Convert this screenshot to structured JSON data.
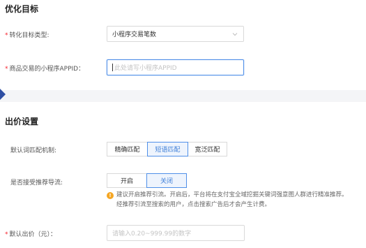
{
  "optimization": {
    "title": "优化目标",
    "conversion_type_label": "转化目标类型:",
    "conversion_type_value": "小程序交易笔数",
    "appid_label": "商品交易的小程序APPID：",
    "appid_placeholder": "此处请写小程序APPID"
  },
  "bidding": {
    "title": "出价设置",
    "keyword_match_label": "默认词匹配机制:",
    "match_options": [
      "精确匹配",
      "短语匹配",
      "宽泛匹配"
    ],
    "match_selected": "短语匹配",
    "recommend_label": "是否接受推荐导流:",
    "recommend_options": [
      "开启",
      "关闭"
    ],
    "recommend_selected": "关闭",
    "hint_line1": "建议开启推荐引流。开启后，平台将在支付宝全域挖掘关键词强意图人群进行精准推荐。",
    "hint_line2": "经推荐引流至搜索的用户，点击搜索广告后才会产生计费。",
    "default_bid_label": "默认出价（元）：",
    "default_bid_placeholder": "请输入0.20~999.99的数字"
  },
  "colors": {
    "accent": "#4f8fe8",
    "required": "#f5222d",
    "warning": "#f5a623",
    "divider_tab": "#2f4fa3"
  },
  "icons": [
    "chevron-down-icon",
    "info-icon"
  ]
}
